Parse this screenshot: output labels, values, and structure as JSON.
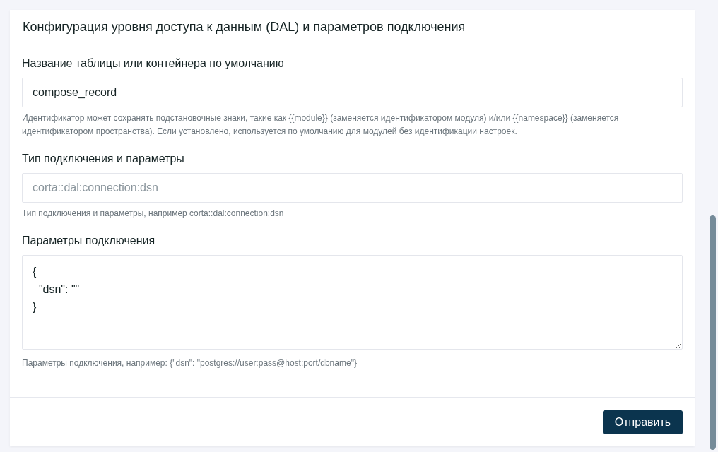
{
  "card": {
    "title": "Конфигурация уровня доступа к данным (DAL) и параметров подключения",
    "fields": [
      {
        "kind": "text",
        "label": "Название таблицы или контейнера по умолчанию",
        "value": "compose_record",
        "hint": "Идентификатор может сохранять подстановочные знаки, такие как {{module}} (заменяется идентификатором модуля) и/или {{namespace}} (заменяется идентификатором пространства). Если установлено, используется по умолчанию для модулей без идентификации настроек."
      },
      {
        "kind": "text",
        "label": "Тип подключения и параметры",
        "placeholder": "corta::dal:connection:dsn",
        "hint": "Тип подключения и параметры, например corta::dal:connection:dsn"
      },
      {
        "kind": "textarea",
        "label": "Параметры подключения",
        "value": "{\n  \"dsn\": \"\"\n}",
        "hint": "Параметры подключения, например: {\"dsn\": \"postgres://user:pass@host:port/dbname\"}"
      }
    ],
    "submit": "Отправить"
  }
}
